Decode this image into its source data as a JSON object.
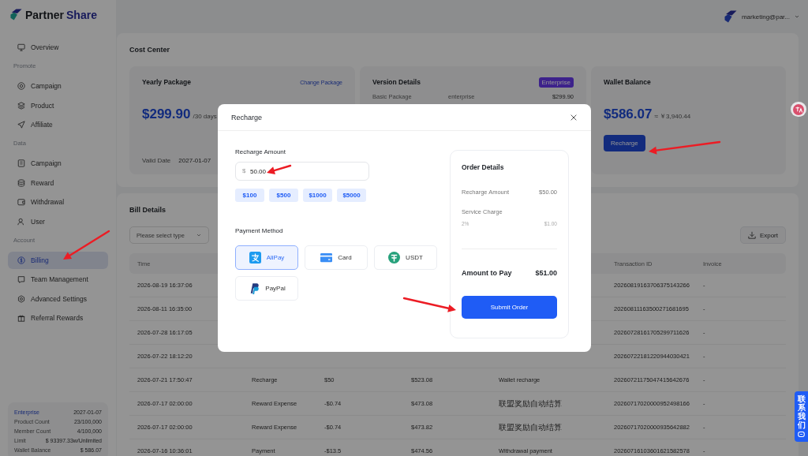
{
  "header": {
    "logo": {
      "first": "Partner",
      "second": "Share"
    },
    "user": "marketing@par..."
  },
  "sidebar": {
    "sections": [
      {
        "items": [
          {
            "label": "Overview",
            "selected": false
          }
        ]
      },
      {
        "title": "Promote",
        "items": [
          {
            "label": "Campaign",
            "selected": false
          },
          {
            "label": "Product",
            "selected": false
          },
          {
            "label": "Affiliate",
            "selected": false
          }
        ]
      },
      {
        "title": "Data",
        "items": [
          {
            "label": "Campaign",
            "selected": false
          },
          {
            "label": "Reward",
            "selected": false
          },
          {
            "label": "Withdrawal",
            "selected": false
          },
          {
            "label": "User",
            "selected": false
          }
        ]
      },
      {
        "title": "Account",
        "items": [
          {
            "label": "Billing",
            "selected": true
          },
          {
            "label": "Team Management",
            "selected": false
          },
          {
            "label": "Advanced Settings",
            "selected": false
          },
          {
            "label": "Referral Rewards",
            "selected": false
          }
        ]
      }
    ],
    "plan_card": {
      "plan": "Enterprise",
      "date": "2027-01-07",
      "rows": [
        {
          "label": "Product Count",
          "value": "23/100,000"
        },
        {
          "label": "Member Count",
          "value": "4/100,000"
        },
        {
          "label": "Limit",
          "value": "$ 93397.33w/Unlimited"
        },
        {
          "label": "Wallet Balance",
          "value": "$ 586.07"
        }
      ]
    }
  },
  "cost_center": {
    "title": "Cost Center",
    "yearly_package": {
      "title": "Yearly Package",
      "link": "Change Package",
      "price": "$299.90",
      "period": "/30 days",
      "valid_label": "Valid Date",
      "valid_date": "2027-01-07"
    },
    "version_details": {
      "title": "Version Details",
      "badge": "Enterprise",
      "rows": [
        {
          "name": "Basic Package",
          "plan": "enterprise",
          "price": "$299.90"
        }
      ]
    },
    "wallet": {
      "title": "Wallet Balance",
      "amount": "$586.07",
      "approx": "≈ ￥3,940.44",
      "button": "Recharge"
    }
  },
  "bill_details": {
    "title": "Bill Details",
    "filter": {
      "placeholder": "Please select type"
    },
    "export": "Export",
    "table": {
      "columns": [
        {
          "label": "Time"
        },
        {},
        {},
        {},
        {},
        {
          "label": "Transaction ID"
        },
        {
          "label": "Invoice"
        }
      ],
      "rows": [
        {
          "cells": [
            "2026-08-19 16:37:06",
            null,
            null,
            null,
            null,
            "20260819163706375143266",
            "-"
          ]
        },
        {
          "cells": [
            "2026-08-11 16:35:00",
            null,
            null,
            null,
            null,
            "20260811163500271681695",
            "-"
          ]
        },
        {
          "cells": [
            "2026-07-28 16:17:05",
            null,
            null,
            null,
            null,
            "20260728161705299711626",
            "-"
          ]
        },
        {
          "cells": [
            "2026-07-22 18:12:20",
            null,
            null,
            null,
            null,
            "20260722181220944030421",
            "-"
          ]
        },
        {
          "cells": [
            "2026-07-21 17:50:47",
            "Recharge",
            "$50",
            "$523.08",
            "Wallet recharge",
            "20260721175047415642676",
            "-"
          ]
        },
        {
          "cells": [
            "2026-07-17 02:00:00",
            "Reward Expense",
            "-$0.74",
            "$473.08",
            "联盟奖励自动结算",
            "20260717020000952498166",
            "-"
          ]
        },
        {
          "cells": [
            "2026-07-17 02:00:00",
            "Reward Expense",
            "-$0.74",
            "$473.82",
            "联盟奖励自动结算",
            "20260717020000935642882",
            "-"
          ]
        },
        {
          "cells": [
            "2026-07-16 10:36:01",
            "Payment",
            "-$13.5",
            "$474.56",
            "Withdrawal payment",
            "20260716103601621582578",
            "-"
          ]
        }
      ]
    }
  },
  "modal": {
    "title": "Recharge",
    "amount_label": "Recharge Amount",
    "amount": {
      "prefix": "$",
      "value": "50.00"
    },
    "presets": [
      "$100",
      "$500",
      "$1000",
      "$5000"
    ],
    "payment_label": "Payment Method",
    "methods": [
      {
        "label": "AliPay",
        "selected": true
      },
      {
        "label": "Card",
        "selected": false
      },
      {
        "label": "USDT",
        "selected": false
      },
      {
        "label": "PayPal",
        "selected": false
      }
    ],
    "order": {
      "title": "Order Details",
      "rows": [
        {
          "label": "Recharge Amount",
          "value": "$50.00"
        },
        {
          "label": "Service Charge",
          "note": "2%",
          "value": "$1.00"
        }
      ],
      "total_label": "Amount to Pay",
      "total": "$51.00",
      "button": "Submit Order"
    }
  },
  "contact_tab": "联系我们"
}
